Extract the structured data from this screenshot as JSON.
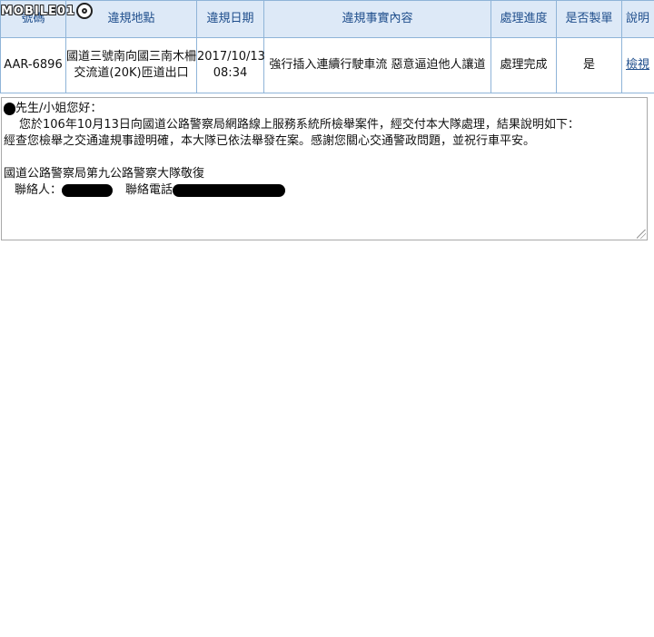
{
  "watermark": "MOBILE01",
  "table": {
    "headers": [
      "號碼",
      "違規地點",
      "違規日期",
      "違規事實內容",
      "處理進度",
      "是否製單",
      "說明"
    ],
    "row": {
      "plate": "AAR-6896",
      "location": "國道三號南向國三南木柵交流道(20K)匝道出口",
      "date": "2017/10/13 08:34",
      "content": "強行插入連續行駛車流 惡意逼迫他人讓道",
      "status": "處理完成",
      "ticket": "是",
      "link": "檢視"
    }
  },
  "message": {
    "greeting": "先生/小姐您好：",
    "line1": "您於106年10月13日向國道公路警察局網路線上服務系統所檢舉案件，經交付本大隊處理，結果說明如下：",
    "line2": "經查您檢舉之交通違規事證明確，本大隊已依法舉發在案。感謝您關心交通警政問題，並祝行車平安。",
    "signature": "國道公路警察局第九公路警察大隊敬復",
    "contact_label": "聯絡人：",
    "phone_label": "聯絡電話"
  }
}
